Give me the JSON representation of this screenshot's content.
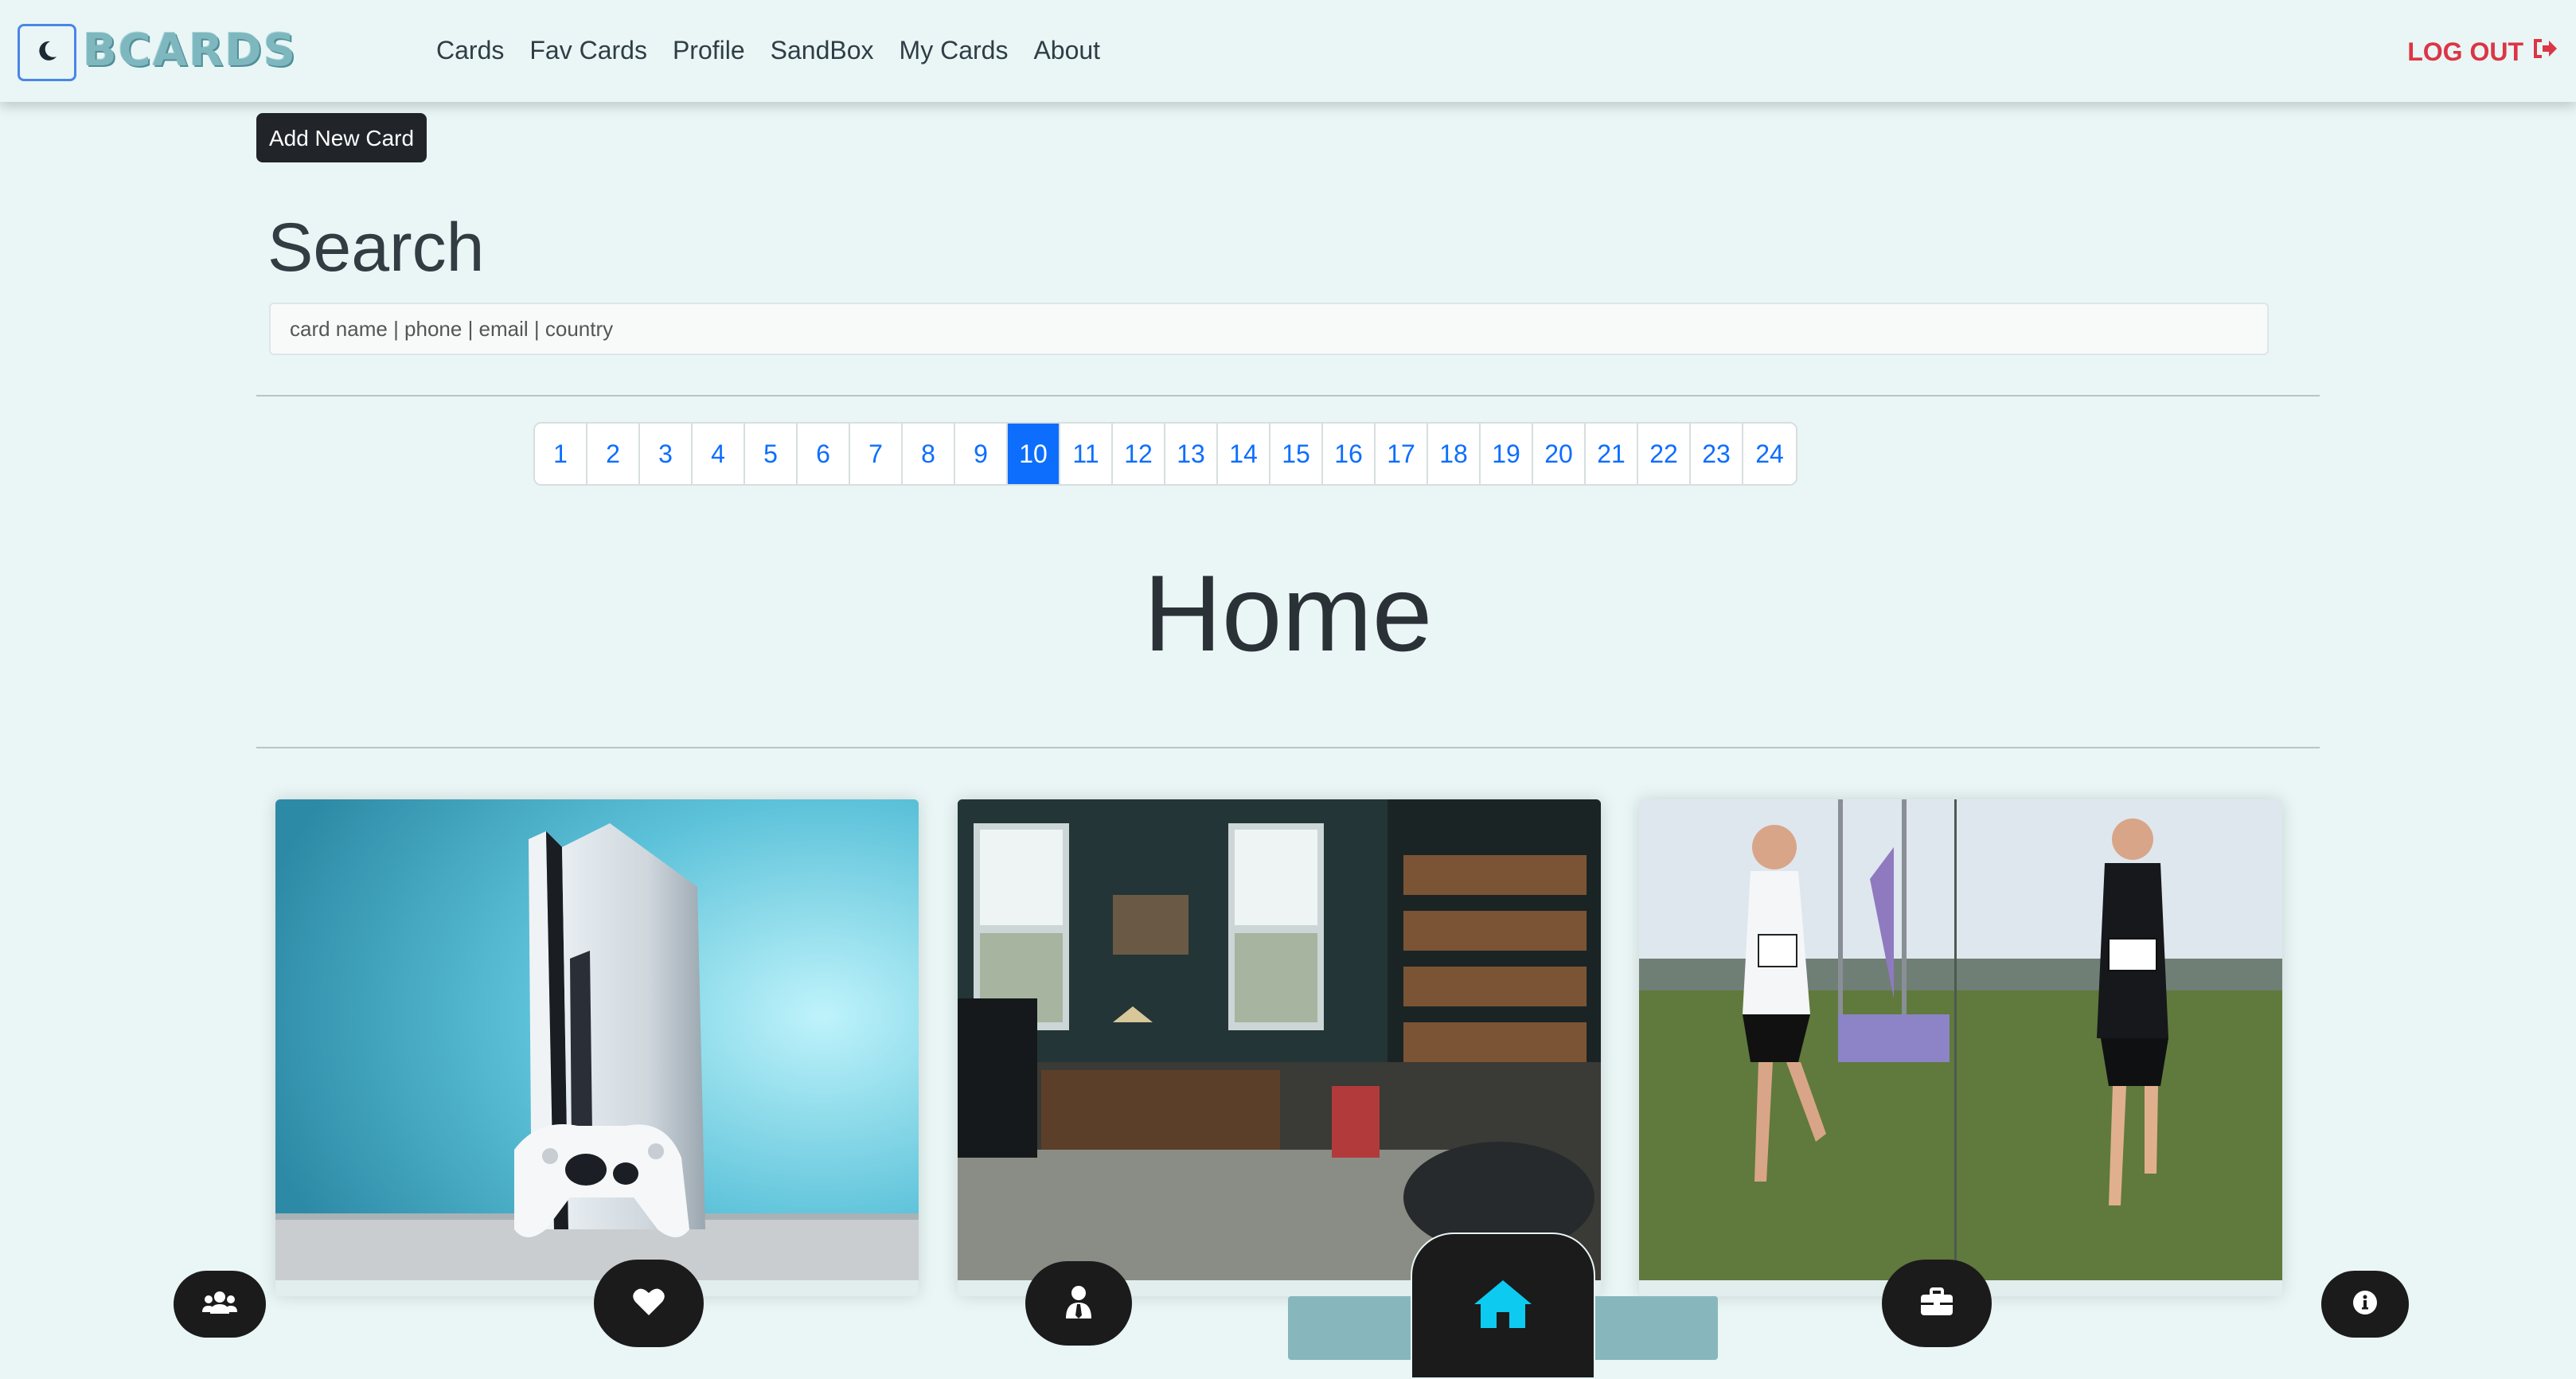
{
  "navbar": {
    "logo_text": "BCARDS",
    "theme_icon": "moon-icon",
    "links": [
      "Cards",
      "Fav Cards",
      "Profile",
      "SandBox",
      "My Cards",
      "About"
    ],
    "logout_label": "LOG OUT",
    "logout_icon": "sign-out-icon",
    "logout_color": "#dc3545"
  },
  "toolbar": {
    "add_card_label": "Add New Card"
  },
  "search": {
    "title": "Search",
    "placeholder": "card name   |   phone   |   email   |   country"
  },
  "pagination": {
    "pages": [
      "1",
      "2",
      "3",
      "4",
      "5",
      "6",
      "7",
      "8",
      "9",
      "10",
      "11",
      "12",
      "13",
      "14",
      "15",
      "16",
      "17",
      "18",
      "19",
      "20",
      "21",
      "22",
      "23",
      "24"
    ],
    "active_page": "10",
    "accent": "#0d6efd"
  },
  "main": {
    "title": "Home"
  },
  "cards": [
    {
      "image": "game-console-photo"
    },
    {
      "image": "library-room-photo"
    },
    {
      "image": "runners-race-photo"
    }
  ],
  "bottom_nav": {
    "items": [
      "users-icon",
      "heart-icon",
      "user-tie-icon",
      "home-icon",
      "briefcase-icon",
      "info-icon"
    ],
    "active": "home-icon",
    "active_color": "#0dcaf0"
  }
}
